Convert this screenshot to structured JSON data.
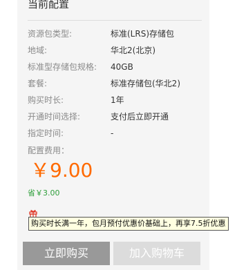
{
  "panel": {
    "title": "当前配置"
  },
  "specs": [
    {
      "label": "资源包类型:",
      "value": "标准(LRS)存储包"
    },
    {
      "label": "地域:",
      "value": "华北2(北京)"
    },
    {
      "label": "标准型存储包规格:",
      "value": "40GB"
    },
    {
      "label": "套餐:",
      "value": "标准存储包(华北2)"
    },
    {
      "label": "购买时长:",
      "value": "1年"
    },
    {
      "label": "开通时间选择:",
      "value": "支付后立即开通"
    },
    {
      "label": "指定时间:",
      "value": "-"
    }
  ],
  "fee": {
    "label": "配置费用：",
    "price": "￥9.00",
    "saving": "省￥3.00"
  },
  "promo": {
    "icon": "gift-icon",
    "text": "购买时长满一年，包月预付优惠价基础上，再享7.5折优惠"
  },
  "buttons": {
    "buy_label": "立即购买",
    "cart_label": "加入购物车"
  },
  "colors": {
    "price": "#ff6a00",
    "saving": "#2e9e3a",
    "buy_button": "#999999",
    "cart_button": "#dcdcdc"
  }
}
